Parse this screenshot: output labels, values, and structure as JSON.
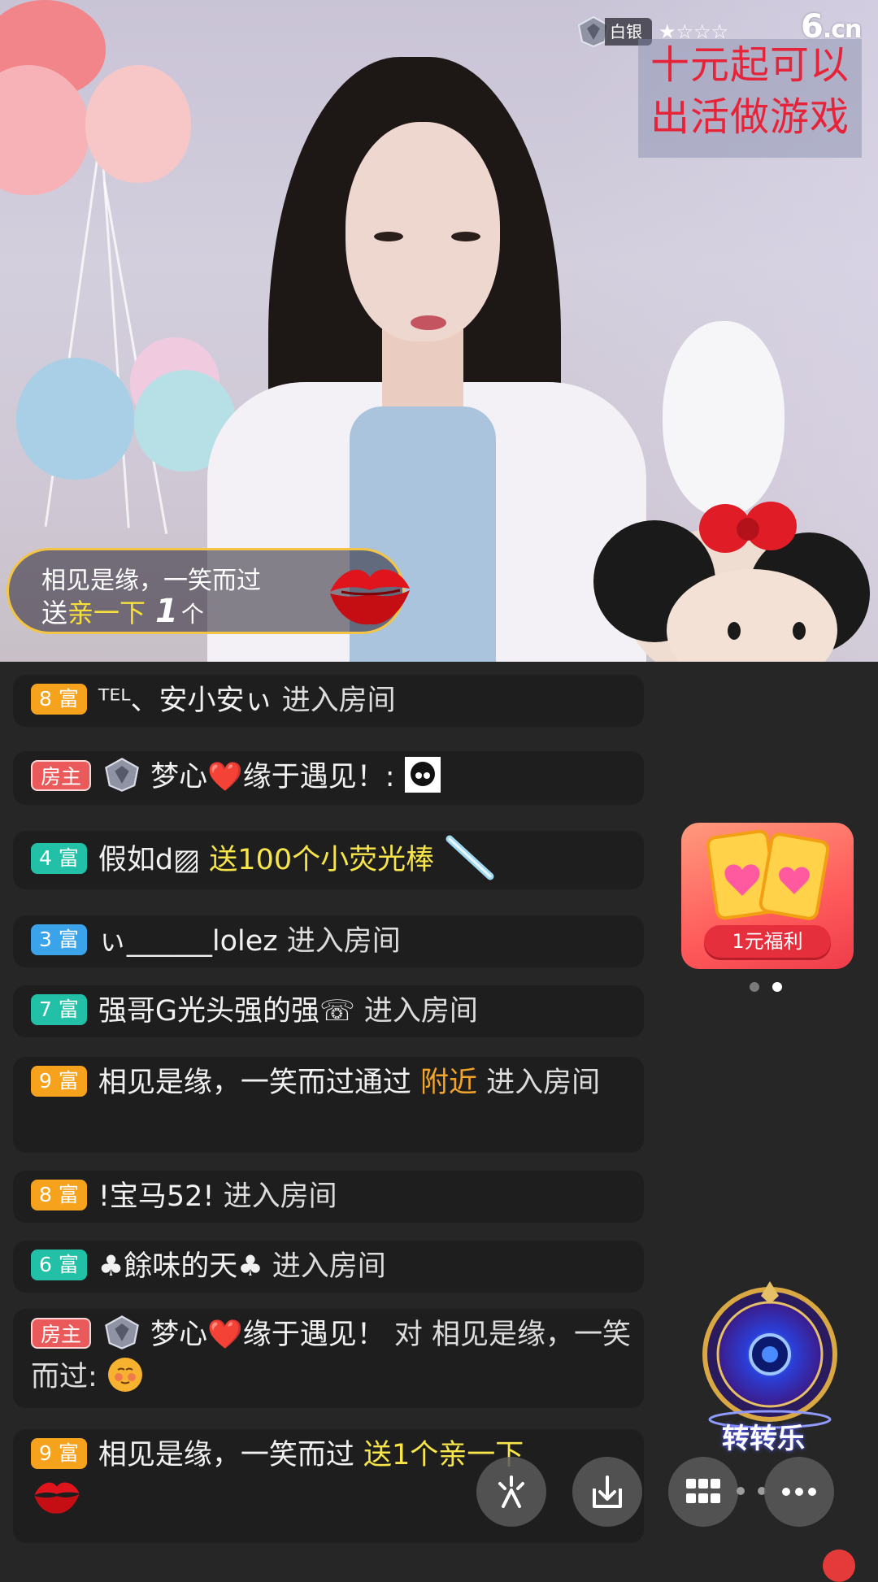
{
  "stream": {
    "level_label": "白银",
    "level_stars": "★☆☆☆",
    "site_logo": "6",
    "site_logo_suffix": ".cn",
    "promo_lines": [
      "十元起可以",
      "出活做游戏"
    ]
  },
  "gift_toast": {
    "user": "相见是缘，一笑而过",
    "verb": "送",
    "gift_name": "亲一下",
    "count": "1",
    "unit": "个"
  },
  "chat": {
    "messages": [
      {
        "badge": "8 富",
        "badge_color": "#f6a21d",
        "name": "ᵀᴱᴸ、安小安ぃ",
        "text": "进入房间"
      },
      {
        "badge": "房主",
        "badge_color": "#ea5a5a",
        "name": "梦心❤️缘于遇见！:",
        "text": ""
      },
      {
        "badge": "4 富",
        "badge_color": "#22c1a7",
        "name": "假如d▨",
        "text": "送100个小荧光棒"
      },
      {
        "badge": "3 富",
        "badge_color": "#3ba3ea",
        "name": "ぃ______lolez",
        "text": "进入房间"
      },
      {
        "badge": "7 富",
        "badge_color": "#22c1a7",
        "name": "强哥G光头强的强☏",
        "text": "进入房间"
      },
      {
        "badge": "9 富",
        "badge_color": "#f6a21d",
        "name": "相见是缘，一笑而过通过",
        "highlight": "附近",
        "text": "进入房间"
      },
      {
        "badge": "8 富",
        "badge_color": "#f6a21d",
        "name": "!宝马52!",
        "text": "进入房间"
      },
      {
        "badge": "6 富",
        "badge_color": "#22c1a7",
        "name": "♣餘味的天♣",
        "text": "进入房间"
      },
      {
        "badge": "房主",
        "badge_color": "#ea5a5a",
        "name": "梦心❤️缘于遇见！",
        "text": "对 相见是缘，一笑而过:"
      },
      {
        "badge": "9 富",
        "badge_color": "#f6a21d",
        "name": "相见是缘，一笑而过",
        "text": "送1个亲一下"
      }
    ]
  },
  "sidebar": {
    "promo_card_label": "1元福利",
    "wheel_label": "转转乐"
  },
  "toolbar": {
    "buttons": [
      "share-icon",
      "download-icon",
      "apps-grid-icon",
      "more-icon"
    ]
  }
}
